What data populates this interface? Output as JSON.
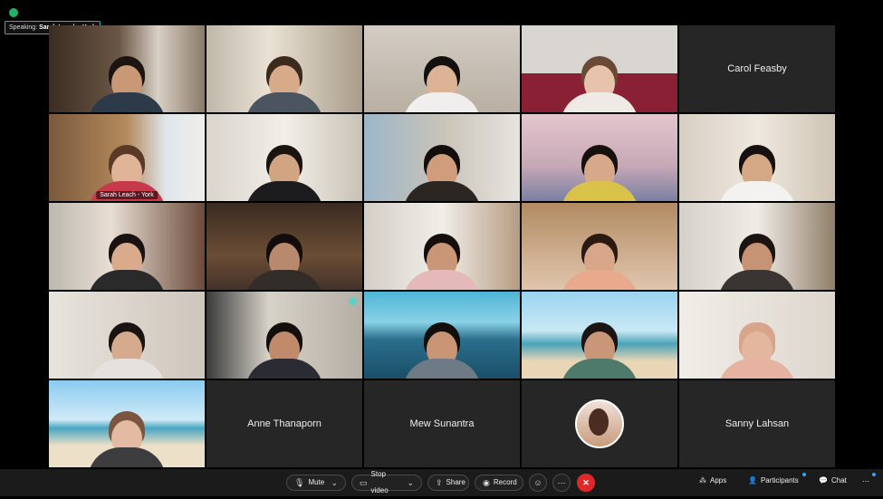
{
  "window": {
    "speaking_prefix": "Speaking:",
    "speaking_name": "Sarah Leach - York"
  },
  "tiles": [
    {
      "label": "",
      "type": "video"
    },
    {
      "label": "",
      "type": "video"
    },
    {
      "label": "",
      "type": "video"
    },
    {
      "label": "",
      "type": "video"
    },
    {
      "label": "Carol Feasby",
      "type": "name"
    },
    {
      "label": "Sarah Leach - York",
      "type": "video-active"
    },
    {
      "label": "",
      "type": "video"
    },
    {
      "label": "",
      "type": "video"
    },
    {
      "label": "",
      "type": "video"
    },
    {
      "label": "",
      "type": "video"
    },
    {
      "label": "",
      "type": "video"
    },
    {
      "label": "",
      "type": "video"
    },
    {
      "label": "",
      "type": "video"
    },
    {
      "label": "",
      "type": "video"
    },
    {
      "label": "",
      "type": "video"
    },
    {
      "label": "",
      "type": "video"
    },
    {
      "label": "",
      "type": "video"
    },
    {
      "label": "",
      "type": "video"
    },
    {
      "label": "",
      "type": "video"
    },
    {
      "label": "",
      "type": "video"
    },
    {
      "label": "",
      "type": "video"
    },
    {
      "label": "Anne Thanaporn",
      "type": "name"
    },
    {
      "label": "Mew Sunantra",
      "type": "name"
    },
    {
      "label": "",
      "type": "avatar"
    },
    {
      "label": "Sanny Lahsan",
      "type": "name"
    }
  ],
  "toolbar": {
    "mute": "Mute",
    "stop_video": "Stop video",
    "share": "Share",
    "record": "Record",
    "apps": "Apps",
    "participants": "Participants",
    "chat": "Chat"
  },
  "colors": {
    "accent": "#27b0c9",
    "end_call": "#e02828",
    "background": "#000000",
    "toolbar": "#1b1b1b"
  }
}
